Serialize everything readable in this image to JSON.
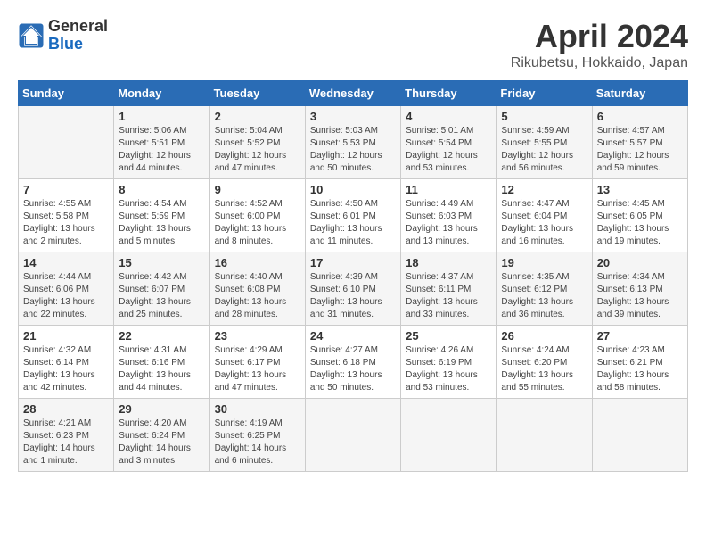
{
  "header": {
    "logo_general": "General",
    "logo_blue": "Blue",
    "month_title": "April 2024",
    "location": "Rikubetsu, Hokkaido, Japan"
  },
  "weekdays": [
    "Sunday",
    "Monday",
    "Tuesday",
    "Wednesday",
    "Thursday",
    "Friday",
    "Saturday"
  ],
  "weeks": [
    [
      {
        "day": "",
        "info": ""
      },
      {
        "day": "1",
        "info": "Sunrise: 5:06 AM\nSunset: 5:51 PM\nDaylight: 12 hours\nand 44 minutes."
      },
      {
        "day": "2",
        "info": "Sunrise: 5:04 AM\nSunset: 5:52 PM\nDaylight: 12 hours\nand 47 minutes."
      },
      {
        "day": "3",
        "info": "Sunrise: 5:03 AM\nSunset: 5:53 PM\nDaylight: 12 hours\nand 50 minutes."
      },
      {
        "day": "4",
        "info": "Sunrise: 5:01 AM\nSunset: 5:54 PM\nDaylight: 12 hours\nand 53 minutes."
      },
      {
        "day": "5",
        "info": "Sunrise: 4:59 AM\nSunset: 5:55 PM\nDaylight: 12 hours\nand 56 minutes."
      },
      {
        "day": "6",
        "info": "Sunrise: 4:57 AM\nSunset: 5:57 PM\nDaylight: 12 hours\nand 59 minutes."
      }
    ],
    [
      {
        "day": "7",
        "info": "Sunrise: 4:55 AM\nSunset: 5:58 PM\nDaylight: 13 hours\nand 2 minutes."
      },
      {
        "day": "8",
        "info": "Sunrise: 4:54 AM\nSunset: 5:59 PM\nDaylight: 13 hours\nand 5 minutes."
      },
      {
        "day": "9",
        "info": "Sunrise: 4:52 AM\nSunset: 6:00 PM\nDaylight: 13 hours\nand 8 minutes."
      },
      {
        "day": "10",
        "info": "Sunrise: 4:50 AM\nSunset: 6:01 PM\nDaylight: 13 hours\nand 11 minutes."
      },
      {
        "day": "11",
        "info": "Sunrise: 4:49 AM\nSunset: 6:03 PM\nDaylight: 13 hours\nand 13 minutes."
      },
      {
        "day": "12",
        "info": "Sunrise: 4:47 AM\nSunset: 6:04 PM\nDaylight: 13 hours\nand 16 minutes."
      },
      {
        "day": "13",
        "info": "Sunrise: 4:45 AM\nSunset: 6:05 PM\nDaylight: 13 hours\nand 19 minutes."
      }
    ],
    [
      {
        "day": "14",
        "info": "Sunrise: 4:44 AM\nSunset: 6:06 PM\nDaylight: 13 hours\nand 22 minutes."
      },
      {
        "day": "15",
        "info": "Sunrise: 4:42 AM\nSunset: 6:07 PM\nDaylight: 13 hours\nand 25 minutes."
      },
      {
        "day": "16",
        "info": "Sunrise: 4:40 AM\nSunset: 6:08 PM\nDaylight: 13 hours\nand 28 minutes."
      },
      {
        "day": "17",
        "info": "Sunrise: 4:39 AM\nSunset: 6:10 PM\nDaylight: 13 hours\nand 31 minutes."
      },
      {
        "day": "18",
        "info": "Sunrise: 4:37 AM\nSunset: 6:11 PM\nDaylight: 13 hours\nand 33 minutes."
      },
      {
        "day": "19",
        "info": "Sunrise: 4:35 AM\nSunset: 6:12 PM\nDaylight: 13 hours\nand 36 minutes."
      },
      {
        "day": "20",
        "info": "Sunrise: 4:34 AM\nSunset: 6:13 PM\nDaylight: 13 hours\nand 39 minutes."
      }
    ],
    [
      {
        "day": "21",
        "info": "Sunrise: 4:32 AM\nSunset: 6:14 PM\nDaylight: 13 hours\nand 42 minutes."
      },
      {
        "day": "22",
        "info": "Sunrise: 4:31 AM\nSunset: 6:16 PM\nDaylight: 13 hours\nand 44 minutes."
      },
      {
        "day": "23",
        "info": "Sunrise: 4:29 AM\nSunset: 6:17 PM\nDaylight: 13 hours\nand 47 minutes."
      },
      {
        "day": "24",
        "info": "Sunrise: 4:27 AM\nSunset: 6:18 PM\nDaylight: 13 hours\nand 50 minutes."
      },
      {
        "day": "25",
        "info": "Sunrise: 4:26 AM\nSunset: 6:19 PM\nDaylight: 13 hours\nand 53 minutes."
      },
      {
        "day": "26",
        "info": "Sunrise: 4:24 AM\nSunset: 6:20 PM\nDaylight: 13 hours\nand 55 minutes."
      },
      {
        "day": "27",
        "info": "Sunrise: 4:23 AM\nSunset: 6:21 PM\nDaylight: 13 hours\nand 58 minutes."
      }
    ],
    [
      {
        "day": "28",
        "info": "Sunrise: 4:21 AM\nSunset: 6:23 PM\nDaylight: 14 hours\nand 1 minute."
      },
      {
        "day": "29",
        "info": "Sunrise: 4:20 AM\nSunset: 6:24 PM\nDaylight: 14 hours\nand 3 minutes."
      },
      {
        "day": "30",
        "info": "Sunrise: 4:19 AM\nSunset: 6:25 PM\nDaylight: 14 hours\nand 6 minutes."
      },
      {
        "day": "",
        "info": ""
      },
      {
        "day": "",
        "info": ""
      },
      {
        "day": "",
        "info": ""
      },
      {
        "day": "",
        "info": ""
      }
    ]
  ]
}
